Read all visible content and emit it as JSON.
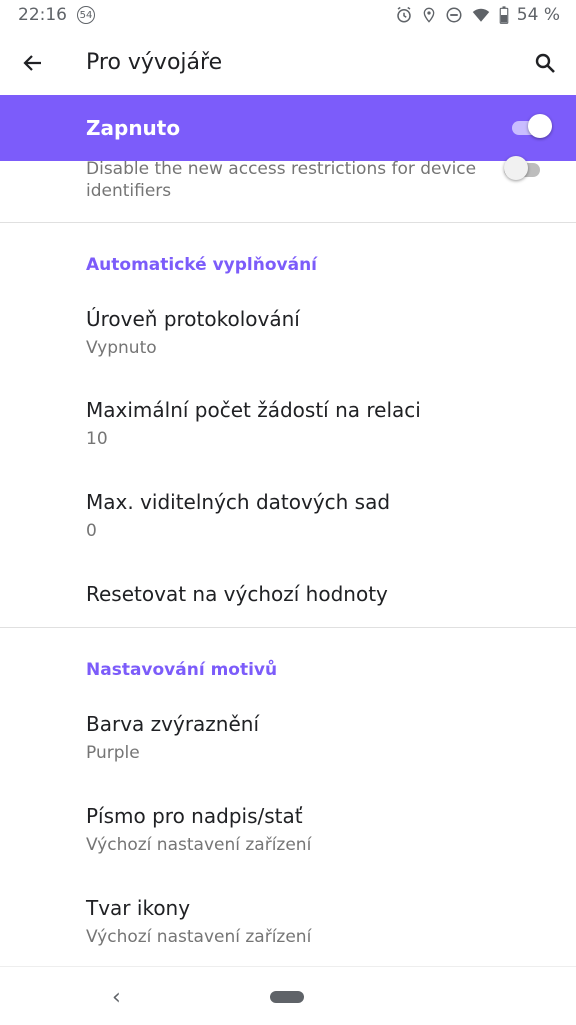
{
  "status_bar": {
    "time": "22:16",
    "notification_count": "54",
    "battery": "54 %",
    "icons": [
      "alarm-icon",
      "location-icon",
      "dnd-icon",
      "wifi-icon",
      "battery-icon"
    ]
  },
  "app_bar": {
    "title": "Pro vývojáře"
  },
  "master_switch": {
    "label": "Zapnuto",
    "on": true,
    "accent_color": "#7c5cfa"
  },
  "partial_item": {
    "summary": "Disable the new access restrictions for device identifiers",
    "on": false
  },
  "sections": [
    {
      "header": "Automatické vyplňování",
      "items": [
        {
          "title": "Úroveň protokolování",
          "summary": "Vypnuto"
        },
        {
          "title": "Maximální počet žádostí na relaci",
          "summary": "10"
        },
        {
          "title": "Max. viditelných datových sad",
          "summary": "0"
        },
        {
          "title": "Resetovat na výchozí hodnoty",
          "summary": ""
        }
      ]
    },
    {
      "header": "Nastavování motivů",
      "items": [
        {
          "title": "Barva zvýraznění",
          "summary": "Purple"
        },
        {
          "title": "Písmo pro nadpis/stať",
          "summary": "Výchozí nastavení zařízení"
        },
        {
          "title": "Tvar ikony",
          "summary": "Výchozí nastavení zařízení"
        }
      ]
    }
  ],
  "nav_bar": {
    "back_glyph": "‹"
  }
}
